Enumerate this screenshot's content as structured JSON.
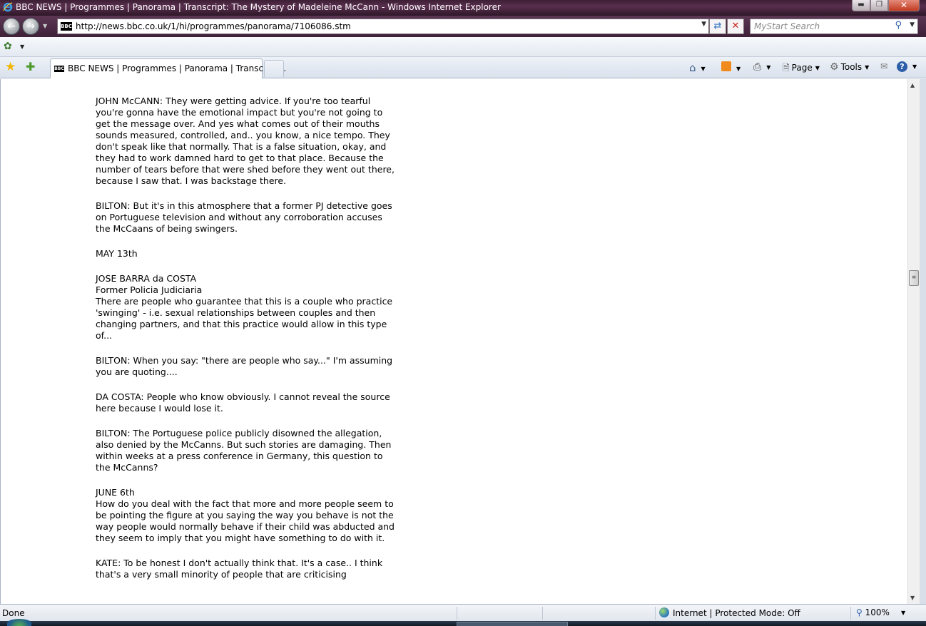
{
  "window": {
    "title": "BBC NEWS | Programmes | Panorama | Transcript: The Mystery of Madeleine McCann - Windows Internet Explorer",
    "minimize_glyph": "▬",
    "maximize_glyph": "❐",
    "close_glyph": "✕"
  },
  "address_bar": {
    "favicon_text": "BBC",
    "url": "http://news.bbc.co.uk/1/hi/programmes/panorama/7106086.stm",
    "search_placeholder": "MyStart Search"
  },
  "tabs": [
    {
      "favicon_text": "BBC",
      "label": "BBC NEWS | Programmes | Panorama | Transcript..."
    }
  ],
  "command_bar": {
    "page_label": "Page",
    "tools_label": "Tools"
  },
  "article": {
    "paragraphs": [
      "JOHN McCANN: They were getting advice. If you're too tearful you're gonna have the emotional impact but you're not going to get the message over. And yes what comes out of their mouths sounds measured, controlled, and.. you know, a nice tempo. They don't speak like that normally. That is a false situation, okay, and they had to work damned hard to get to that place. Because the number of tears before that were shed before they went out there, because I saw that. I was backstage there.",
      "BILTON: But it's in this atmosphere that a former PJ detective goes on Portuguese television and without any corroboration accuses the McCaans of being swingers.",
      "MAY 13th",
      "JOSE BARRA da COSTA\nFormer Policia Judiciaria\nThere are people who guarantee that this is a couple who practice 'swinging' - i.e. sexual relationships between couples and then changing partners, and that this practice would allow in this type of...",
      "BILTON: When you say: \"there are people who say...\" I'm assuming you are quoting....",
      "DA COSTA: People who know obviously. I cannot reveal the source here because I would lose it.",
      "BILTON: The Portuguese police publicly disowned the allegation, also denied by the McCanns. But such stories are damaging. Then within weeks at a press conference in Germany, this question to the McCanns?",
      "JUNE 6th\nHow do you deal with the fact that more and more people seem to be pointing the figure at you saying the way you behave is not the way people would normally behave if their child was abducted and they seem to imply that you might have something to do with it.",
      "KATE: To be honest I don't actually think that. It's a case.. I think that's a very small minority of people that are criticising"
    ]
  },
  "status_bar": {
    "status_text": "Done",
    "zone_text": "Internet | Protected Mode: Off",
    "zoom_text": "100%"
  }
}
